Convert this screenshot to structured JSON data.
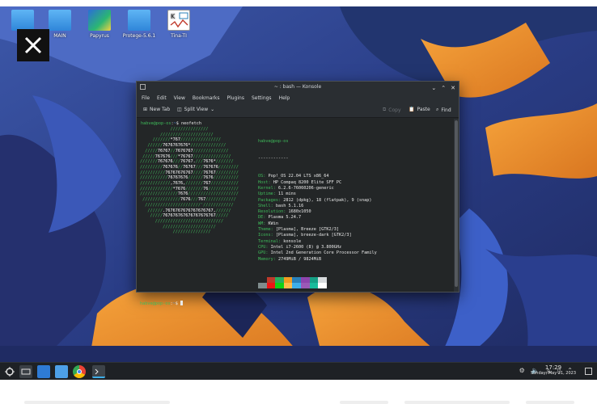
{
  "desktop": {
    "icons": [
      {
        "label": "",
        "icon": "folder-icon"
      },
      {
        "label": "MAIN",
        "icon": "document-folder-icon"
      },
      {
        "label": "Papyrus",
        "icon": "papyrus-app-icon"
      },
      {
        "label": "Protege-5.6.1",
        "icon": "folder-icon"
      },
      {
        "label": "Tina-TI",
        "icon": "tina-ti-app-icon"
      }
    ],
    "overlay_close": "✕"
  },
  "konsole": {
    "title": "~ : bash — Konsole",
    "menu": [
      "File",
      "Edit",
      "View",
      "Bookmarks",
      "Plugins",
      "Settings",
      "Help"
    ],
    "toolbar": {
      "new_tab": "New Tab",
      "split_view": "Split View",
      "copy": "Copy",
      "paste": "Paste",
      "find": "Find"
    },
    "prompt": {
      "user_host": "habve@pop-os",
      "path": "~",
      "symbol": "$"
    },
    "command": "neofetch",
    "logo_lines": [
      "            ///////////////",
      "        /////////////////////",
      "     ///////*767////////////////",
      "   //////7676767676*//////////////",
      "  /////76767//7676767//////////////",
      " /////767676///*76767///////////////",
      "///////767676///76767.///7676*///////",
      "/////////767676//76767///767676////////",
      "//////////76767676767////76767/////////",
      "///////////76767676//////7676//////////",
      "////////////,7676,///////767///////////",
      "/////////////*7676///////76////////////",
      "///////////////7676////////////////////",
      " ///////////////7676///767////////////",
      "  //////////////////////'////////////",
      "   //////.7676767676767676767,//////",
      "    /////767676767676767676767/////",
      "      ///////////////////////////",
      "         /////////////////////",
      "             ///////////////"
    ],
    "info_header": "habve@pop-os",
    "info_separator": "------------",
    "info": [
      {
        "key": "OS",
        "value": "Pop!_OS 22.04 LTS x86_64"
      },
      {
        "key": "Host",
        "value": "HP Compaq 8200 Elite SFF PC"
      },
      {
        "key": "Kernel",
        "value": "6.2.6-76060206-generic"
      },
      {
        "key": "Uptime",
        "value": "11 mins"
      },
      {
        "key": "Packages",
        "value": "2812 (dpkg), 18 (flatpak), 9 (snap)"
      },
      {
        "key": "Shell",
        "value": "bash 5.1.16"
      },
      {
        "key": "Resolution",
        "value": "1680x1050"
      },
      {
        "key": "DE",
        "value": "Plasma 5.24.7"
      },
      {
        "key": "WM",
        "value": "KWin"
      },
      {
        "key": "Theme",
        "value": "[Plasma], Breeze [GTK2/3]"
      },
      {
        "key": "Icons",
        "value": "[Plasma], breeze-dark [GTK2/3]"
      },
      {
        "key": "Terminal",
        "value": "konsole"
      },
      {
        "key": "CPU",
        "value": "Intel i7-2600 (8) @ 3.800GHz"
      },
      {
        "key": "GPU",
        "value": "Intel 2nd Generation Core Processor Family"
      },
      {
        "key": "Memory",
        "value": "2749MiB / 9824MiB"
      }
    ],
    "swatches_dark": [
      "#232627",
      "#c0392b",
      "#27ae60",
      "#f39c1f",
      "#2980b9",
      "#8e44ad",
      "#16a085",
      "#d7dadd"
    ],
    "swatches_bright": [
      "#7f8c8d",
      "#ed1515",
      "#11d116",
      "#fdbc4b",
      "#3daee9",
      "#9b59b6",
      "#1abc9c",
      "#ffffff"
    ]
  },
  "taskbar": {
    "apps": [
      "app-launcher-icon",
      "pager-icon",
      "discover-icon",
      "dolphin-icon",
      "chrome-icon",
      "konsole-icon"
    ],
    "tray": [
      "settings-tray-icon",
      "volume-icon",
      "network-icon",
      "battery-icon",
      "expand-tray-icon"
    ],
    "time": "17:29",
    "date": "Sunday, May 21, 2023"
  }
}
